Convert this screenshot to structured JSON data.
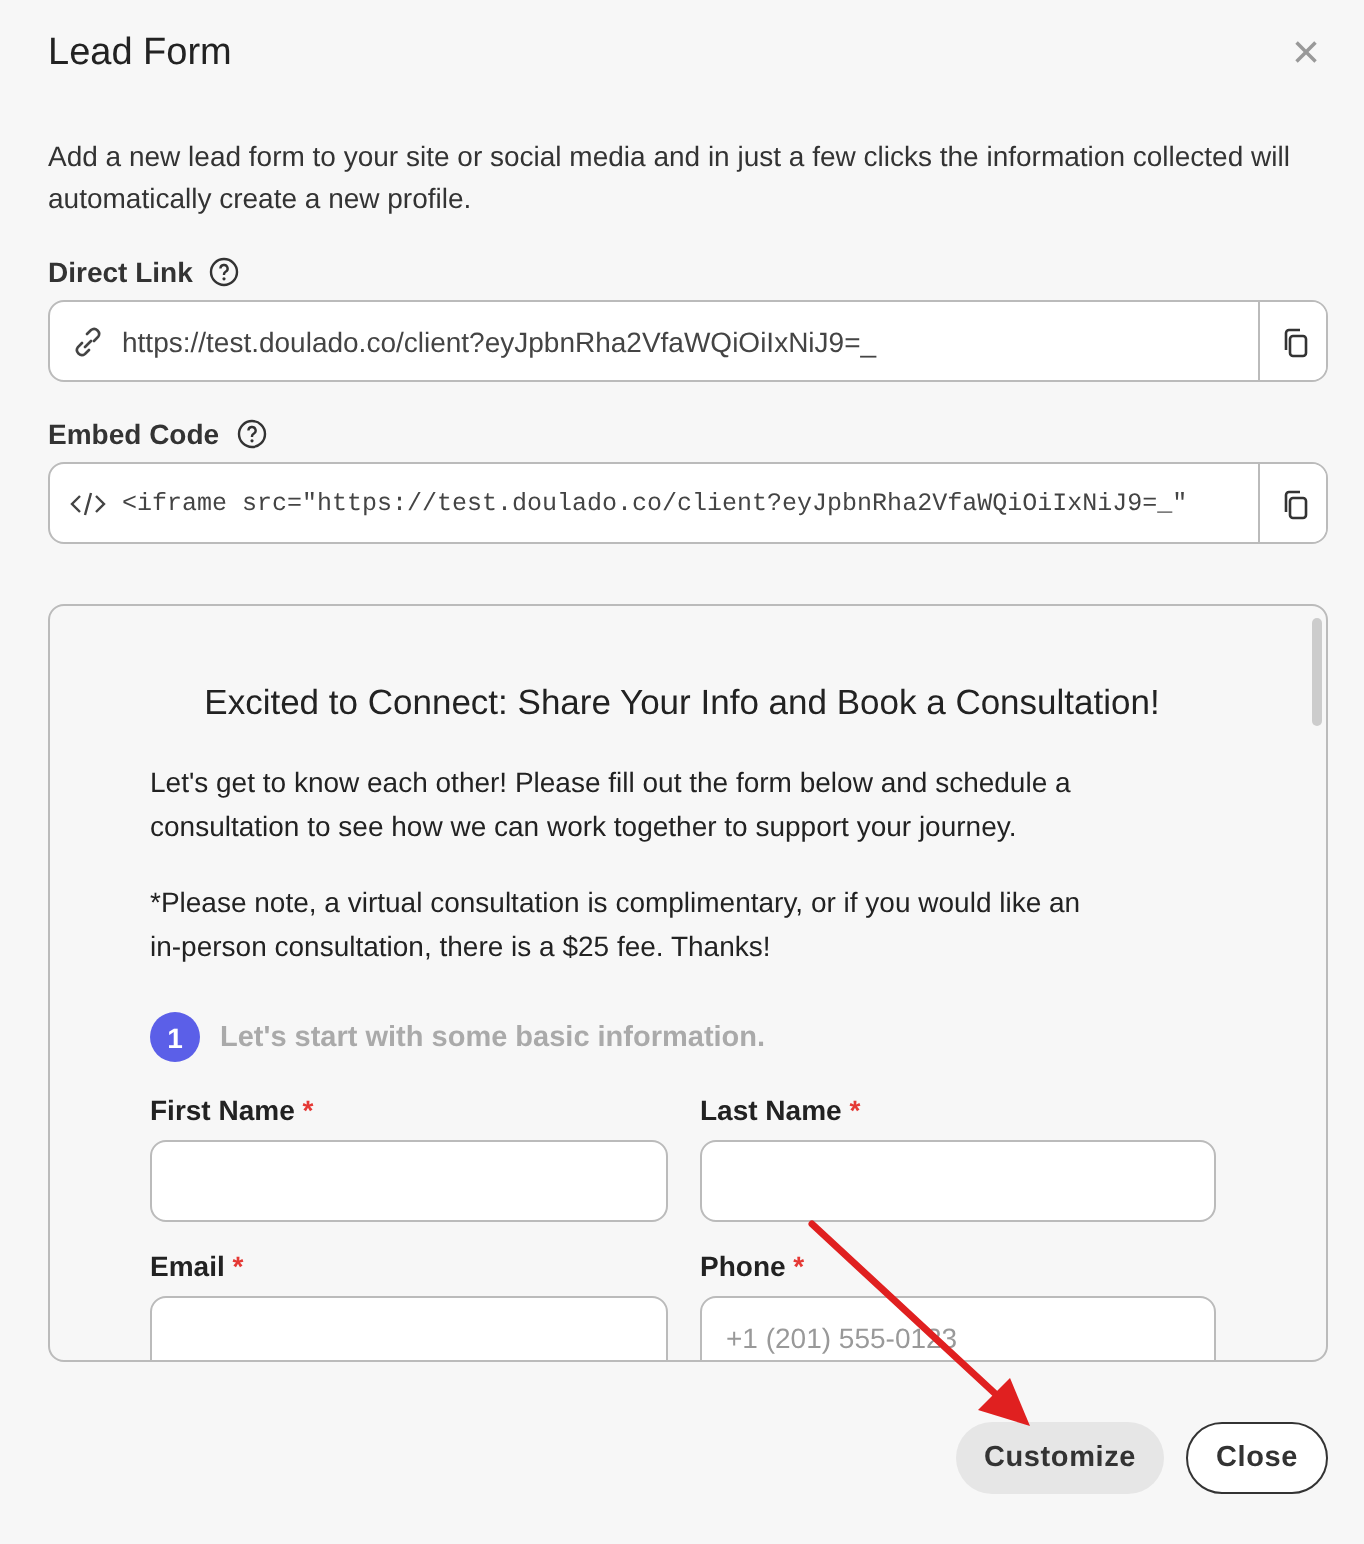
{
  "dialog": {
    "title": "Lead Form",
    "close_icon": "×",
    "description": "Add a new lead form to your site or social media and in just a few clicks the information collected will automatically create a new profile."
  },
  "direct_link": {
    "label": "Direct Link",
    "value": "https://test.doulado.co/client?eyJpbnRha2VfaWQiOiIxNiJ9=_"
  },
  "embed_code": {
    "label": "Embed Code",
    "value": "<iframe src=\"https://test.doulado.co/client?eyJpbnRha2VfaWQiOiIxNiJ9=_\""
  },
  "preview": {
    "heading": "Excited to Connect: Share Your Info and Book a Consultation!",
    "paragraphs": [
      "Let's get to know each other! Please fill out the form below and schedule a consultation to see how we can work together to support your journey.",
      "*Please note, a virtual consultation is complimentary, or if you would like an in-person consultation, there is a $25 fee. Thanks!"
    ],
    "step": {
      "number": "1",
      "label": "Let's start with some basic information."
    },
    "fields": [
      {
        "label": "First Name",
        "required_mark": "*"
      },
      {
        "label": "Last Name",
        "required_mark": "*"
      },
      {
        "label": "Email",
        "required_mark": "*"
      },
      {
        "label": "Phone",
        "required_mark": "*",
        "placeholder": "+1 (201) 555-0123"
      }
    ]
  },
  "buttons": [
    {
      "label": "Customize",
      "kind": "secondary"
    },
    {
      "label": "Close",
      "kind": "outline"
    }
  ]
}
